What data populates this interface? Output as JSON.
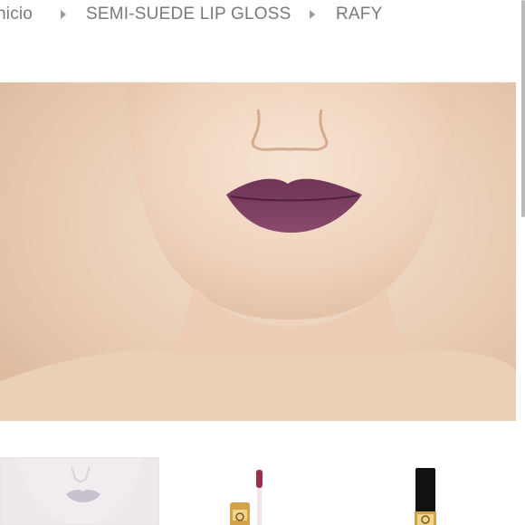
{
  "breadcrumb": {
    "home": "nicio",
    "product": "SEMI-SUEDE LIP GLOSS",
    "current": "RAFY"
  },
  "icons": {
    "separator": "chevron-right-icon"
  },
  "colors": {
    "lip_shade": "#7d3d62",
    "text": "#7a7a7a",
    "background": "#ffffff"
  }
}
